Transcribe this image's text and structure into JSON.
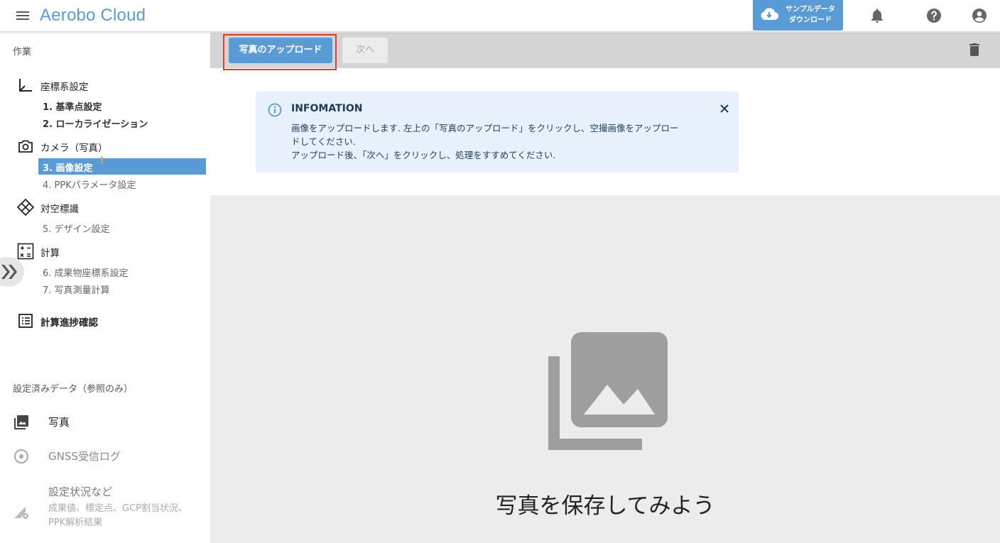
{
  "header": {
    "app_title": "Aerobo Cloud",
    "sample_download": {
      "line1": "サンプルデータ",
      "line2": "ダウンロード",
      "icon": "cloud-download-icon"
    },
    "icons": [
      "menu-icon",
      "bell-icon",
      "help-icon",
      "account-icon"
    ]
  },
  "sidebar": {
    "work_title": "作業",
    "groups": {
      "coord": {
        "label": "座標系設定",
        "icon": "axis-icon"
      },
      "camera": {
        "label": "カメラ（写真）",
        "icon": "camera-icon"
      },
      "targets": {
        "label": "対空標識",
        "icon": "target-marker-icon"
      },
      "calc": {
        "label": "計算",
        "icon": "calculator-icon"
      },
      "progress": {
        "label": "計算進捗確認",
        "icon": "list-icon"
      }
    },
    "steps": {
      "s1": "1. 基準点設定",
      "s2": "2. ローカライゼーション",
      "s3": "3. 画像設定",
      "s3_warning": "!",
      "s4": "4. PPKパラメータ設定",
      "s5": "5. デザイン設定",
      "s6": "6. 成果物座標系設定",
      "s7": "7. 写真測量計算"
    },
    "ref_title": "設定済みデータ（参照のみ）",
    "refs": {
      "photos": {
        "label": "写真",
        "icon": "photo-library-icon"
      },
      "gnss": {
        "label": "GNSS受信ログ",
        "icon": "radio-icon"
      },
      "status": {
        "label": "設定状況など",
        "sub1": "成果値、標定点、GCP割当状況、",
        "sub2": "PPK解析結果",
        "icon": "signal-settings-icon"
      }
    }
  },
  "toolbar": {
    "upload_label": "写真のアップロード",
    "next_label": "次へ",
    "trash_icon": "trash-icon"
  },
  "info": {
    "title": "INFOMATION",
    "line1": "画像をアップロードします. 左上の「写真のアップロード」をクリックし、空撮画像をアップロー",
    "line2": "ドしてください.",
    "line3": "アップロード後、「次へ」をクリックし、処理をすすめてください."
  },
  "empty_state": {
    "text": "写真を保存してみよう",
    "icon": "photo-library-icon"
  },
  "colors": {
    "accent": "#5b9bd5",
    "highlight_border": "#d9402f",
    "warning": "#f5a623",
    "info_bg": "#e8f1fb"
  }
}
